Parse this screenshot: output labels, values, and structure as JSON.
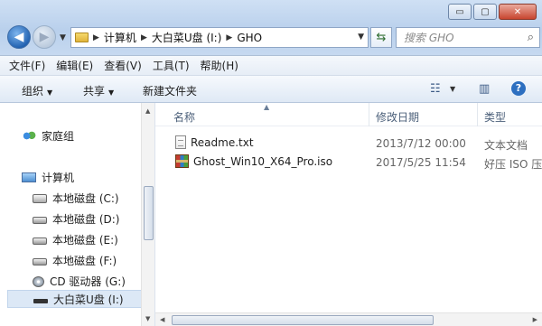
{
  "window": {
    "caption_buttons": {
      "minimize": "▭",
      "maximize": "▢",
      "close": "✕"
    }
  },
  "nav": {
    "back_glyph": "◀",
    "forward_glyph": "▶",
    "breadcrumb": [
      "计算机",
      "大白菜U盘 (I:)",
      "GHO"
    ],
    "search_placeholder": "搜索 GHO"
  },
  "menu": [
    "文件(F)",
    "编辑(E)",
    "查看(V)",
    "工具(T)",
    "帮助(H)"
  ],
  "toolbar": {
    "organize": "组织",
    "share": "共享",
    "new_folder": "新建文件夹"
  },
  "sidebar": {
    "homegroup": "家庭组",
    "computer": "计算机",
    "drives": [
      {
        "label": "本地磁盘 (C:)",
        "icon": "system-drive-icon"
      },
      {
        "label": "本地磁盘 (D:)",
        "icon": "drive-icon"
      },
      {
        "label": "本地磁盘 (E:)",
        "icon": "drive-icon"
      },
      {
        "label": "本地磁盘 (F:)",
        "icon": "drive-icon"
      },
      {
        "label": "CD 驱动器 (G:)",
        "icon": "cd-drive-icon"
      },
      {
        "label": "大白菜U盘 (I:)",
        "icon": "usb-drive-icon",
        "selected": true
      }
    ]
  },
  "columns": {
    "name": "名称",
    "date": "修改日期",
    "type": "类型"
  },
  "files": [
    {
      "name": "Readme.txt",
      "date": "2013/7/12 00:00",
      "type": "文本文档",
      "icon": "text-file-icon"
    },
    {
      "name": "Ghost_Win10_X64_Pro.iso",
      "date": "2017/5/25 11:54",
      "type": "好压 ISO 压",
      "icon": "iso-archive-icon"
    }
  ]
}
